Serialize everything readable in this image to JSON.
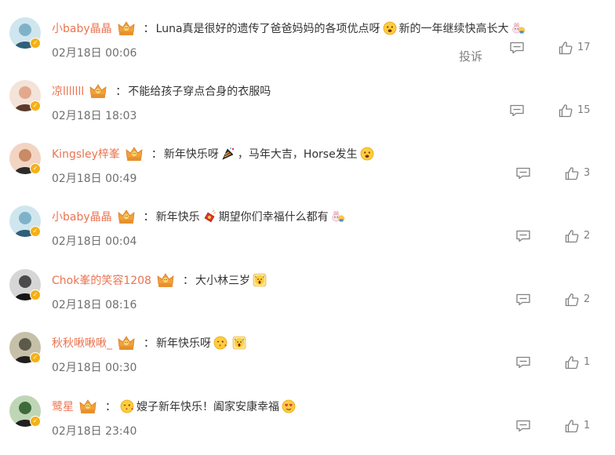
{
  "comments": [
    {
      "username": "小baby晶晶",
      "segments": [
        "Luna真是很好的遗传了爸爸妈妈的各项优点呀",
        "新的一年继续快高长大"
      ],
      "emojis": [
        "grin-emoji",
        "bunny-emoji"
      ],
      "time": "02月18日 00:06",
      "report": "投诉",
      "likes": "17"
    },
    {
      "username": "凉lllllll",
      "segments": [
        "不能给孩子穿点合身的衣服吗"
      ],
      "emojis": [],
      "time": "02月18日 18:03",
      "likes": "15"
    },
    {
      "username": "Kingsley梓峯",
      "segments": [
        "新年快乐呀",
        "，马年大吉，Horse发生"
      ],
      "emojis": [
        "party-horn-emoji",
        "surprised-emoji"
      ],
      "time": "02月18日 00:49",
      "likes": "3"
    },
    {
      "username": "小baby晶晶",
      "segments": [
        "新年快乐",
        "期望你们幸福什么都有"
      ],
      "emojis": [
        "firecracker-emoji",
        "bunny-emoji"
      ],
      "time": "02月18日 00:04",
      "likes": "2"
    },
    {
      "username": "Chok峯的笑容1208",
      "segments": [
        "大小林三岁"
      ],
      "emojis": [
        "shocked-emoji"
      ],
      "time": "02月18日 08:16",
      "likes": "2"
    },
    {
      "username": "秋秋啾啾啾_",
      "segments": [
        "新年快乐呀"
      ],
      "emojis": [
        "kiss-emoji",
        "scream-emoji"
      ],
      "time": "02月18日 00:30",
      "likes": "1"
    },
    {
      "username": "鹭星",
      "segments": [
        "嫂子新年快乐！阖家安康幸福"
      ],
      "emojis": [
        "wink-kiss-emoji",
        "love-emoji"
      ],
      "time": "02月18日 23:40",
      "likes": "1"
    }
  ],
  "colors": {
    "username": "#eb7350",
    "text": "#333333",
    "time": "#6f6f6f",
    "icon": "#808080",
    "badge": "#f5b014"
  },
  "separator": "："
}
